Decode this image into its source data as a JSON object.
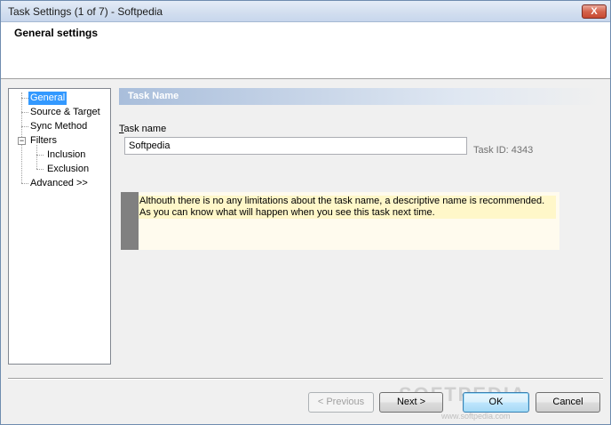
{
  "window": {
    "title": "Task Settings (1 of 7) - Softpedia",
    "close_glyph": "X"
  },
  "header": {
    "heading": "General settings"
  },
  "tree": {
    "items": [
      {
        "label": "General",
        "selected": true
      },
      {
        "label": "Source & Target"
      },
      {
        "label": "Sync Method"
      },
      {
        "label": "Filters",
        "expander": "−"
      },
      {
        "label": "Inclusion"
      },
      {
        "label": "Exclusion"
      },
      {
        "label": "Advanced >>"
      }
    ]
  },
  "section": {
    "title": "Task Name"
  },
  "task_name": {
    "label_prefix": "T",
    "label_rest": "ask name",
    "value": "Softpedia",
    "task_id_text": "Task ID: 4343"
  },
  "info": {
    "message": "Althouth there is no any limitations about the task name, a descriptive name is recommended. As you can know what will happen when you see this task next time."
  },
  "buttons": {
    "previous": "< Previous",
    "next": "Next >",
    "ok": "OK",
    "cancel": "Cancel"
  },
  "watermark": {
    "brand": "SOFTPEDIA",
    "url": "www.softpedia.com"
  }
}
